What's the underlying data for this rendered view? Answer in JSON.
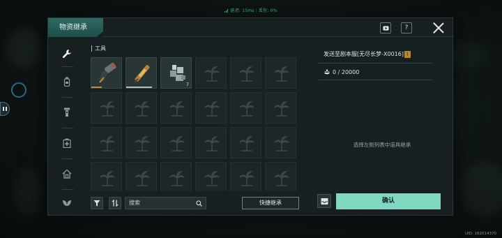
{
  "status_bar": {
    "latency": "延迟: 15ms",
    "packet_loss": "丢包: 0%"
  },
  "uid_text": "UID: 162014370",
  "panel": {
    "title": "物资继承",
    "help_label": "?"
  },
  "nav": {
    "items": [
      {
        "name": "tools",
        "icon": "wrench-icon",
        "active": true
      },
      {
        "name": "consumables",
        "icon": "bottle-icon",
        "active": false
      },
      {
        "name": "equipment",
        "icon": "flashlight-icon",
        "active": false
      },
      {
        "name": "medical",
        "icon": "medkit-icon",
        "active": false
      },
      {
        "name": "building",
        "icon": "house-icon",
        "active": false
      },
      {
        "name": "misc",
        "icon": "leaf-icon",
        "active": false
      }
    ]
  },
  "inventory": {
    "section_title": "工具",
    "items": [
      {
        "icon": "drill-icon",
        "durability": 0.35,
        "bar_color": "#c9872f",
        "qty": ""
      },
      {
        "icon": "lighter-icon",
        "durability": 0.85,
        "bar_color": "#b7c0c0",
        "qty": ""
      },
      {
        "icon": "metal-parts-icon",
        "durability": null,
        "bar_color": "",
        "qty": "7"
      }
    ]
  },
  "toolbar": {
    "search_placeholder": "搜索",
    "quick_inherit": "快捷继承"
  },
  "right": {
    "send_to": "发送至剧本服[无尽长梦-X0016]",
    "tag": "i",
    "weight": "0 / 20000",
    "hint": "选择左侧列表中道具继承",
    "confirm": "确认"
  },
  "colors": {
    "accent": "#7fd8c2",
    "title_tab": "#2d6a63",
    "tag": "#b8862c"
  }
}
